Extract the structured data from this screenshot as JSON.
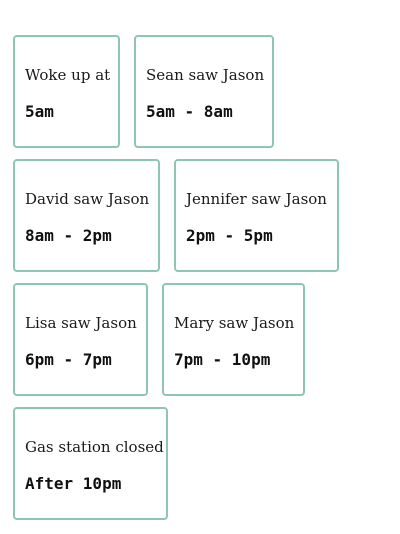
{
  "colors": {
    "border": "#8fc6b3",
    "text": "#1a1a1a"
  },
  "cards": [
    {
      "label": "Woke up at",
      "time": "5am"
    },
    {
      "label": "Sean saw Jason",
      "time": "5am - 8am"
    },
    {
      "label": "David saw Jason",
      "time": "8am - 2pm"
    },
    {
      "label": "Jennifer saw Jason",
      "time": "2pm - 5pm"
    },
    {
      "label": "Lisa saw Jason",
      "time": "6pm - 7pm"
    },
    {
      "label": "Mary saw Jason",
      "time": "7pm - 10pm"
    },
    {
      "label": "Gas station closed",
      "time": "After 10pm"
    }
  ]
}
